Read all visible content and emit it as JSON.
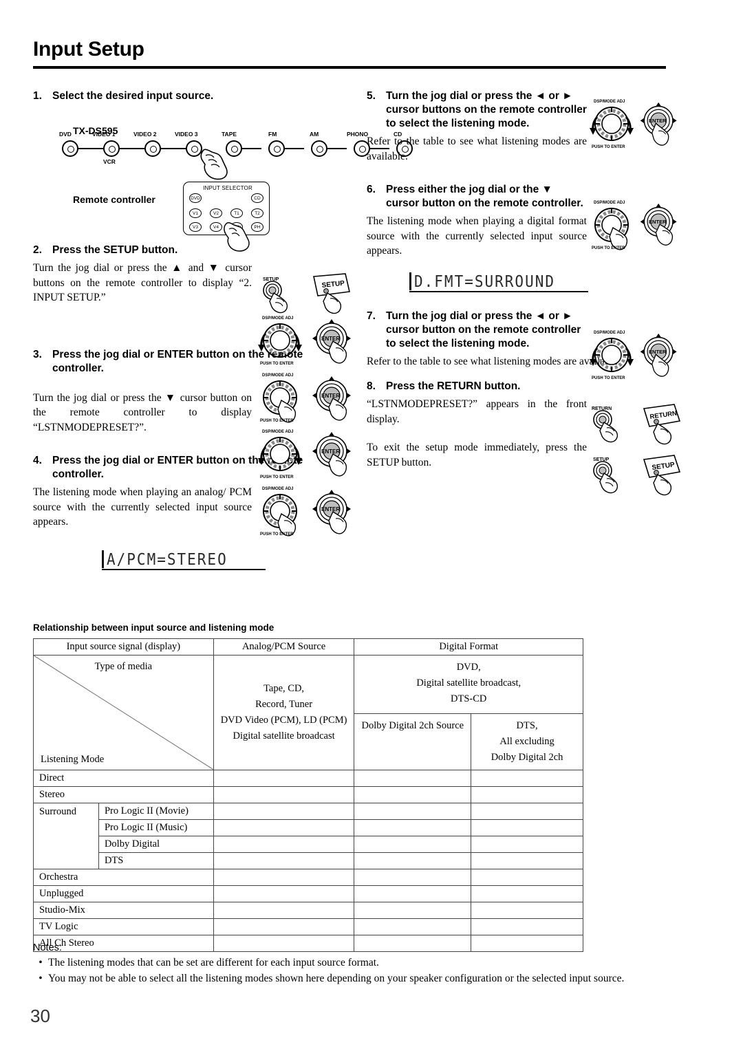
{
  "page": {
    "title": "Input Setup",
    "number": "30"
  },
  "device": {
    "model": "TX-DS595",
    "front_panel_selectors_left": [
      "DVD",
      "VIDEO 1",
      "VIDEO 2",
      "VIDEO 3"
    ],
    "front_panel_sublabel": "VCR",
    "front_panel_selectors_right": [
      "TAPE",
      "FM",
      "AM",
      "PHONO",
      "CD"
    ]
  },
  "remote": {
    "label": "Remote controller",
    "section_label": "INPUT SELECTOR",
    "buttons": [
      "DVD",
      "CD",
      "V1",
      "V2",
      "T1",
      "T2",
      "V3",
      "V4",
      "TUN",
      "PH"
    ]
  },
  "controls": {
    "jog_top_label": "DSP/MODE ADJ",
    "jog_bottom_label": "PUSH TO ENTER",
    "enter_label": "ENTER",
    "setup_label": "SETUP",
    "return_label": "RETURN"
  },
  "steps": [
    {
      "num": "1.",
      "title": "Select the desired input source.",
      "body": ""
    },
    {
      "num": "2.",
      "title": "Press the SETUP button.",
      "body": "Turn the jog dial or press the ▲ and ▼ cursor buttons on the remote controller to display “2. INPUT SETUP.”"
    },
    {
      "num": "3.",
      "title": "Press the jog dial or ENTER button on the remote controller.",
      "body": "Turn the jog dial or press the ▼ cursor button on the remote controller to display “LSTNMODEPRESET?”."
    },
    {
      "num": "4.",
      "title": "Press the jog dial or ENTER button on the remote controller.",
      "body": "The listening mode when playing an analog/ PCM source with the currently selected input source appears."
    },
    {
      "num": "5.",
      "title": "Turn the jog dial or press the ◄ or ► cursor buttons on the remote controller to select the listening mode.",
      "body": "Refer to the table to see what listening modes are available."
    },
    {
      "num": "6.",
      "title": "Press either the jog dial or the ▼ cursor button on the remote controller.",
      "body": "The listening mode when playing a digital format source with the currently selected input source appears."
    },
    {
      "num": "7.",
      "title": "Turn the jog dial or press the ◄ or ► cursor button on the remote controller to select the listening mode.",
      "body": "Refer to the table to see what listening modes are available."
    },
    {
      "num": "8.",
      "title": "Press the RETURN button.",
      "body": "“LSTNMODEPRESET?” appears in the front display.",
      "body2": "To exit the setup mode immediately, press the SETUP button."
    }
  ],
  "displays": {
    "analog_pcm": "A/PCM=STEREO",
    "digital_format": "D.FMT=SURROUND"
  },
  "table": {
    "caption": "Relationship between input source and listening mode",
    "header": {
      "col1": "Input source signal (display)",
      "col2": "Analog/PCM Source",
      "col3": "Digital Format"
    },
    "corner": {
      "top": "Type of media",
      "bottom": "Listening Mode"
    },
    "media": {
      "analog_pcm": [
        "Tape, CD,",
        "Record, Tuner",
        "DVD Video (PCM), LD (PCM)",
        "Digital satellite broadcast"
      ],
      "digital_top": [
        "DVD,",
        "Digital satellite broadcast,",
        "DTS-CD"
      ],
      "digital_sub_left": [
        "Dolby Digital 2ch Source"
      ],
      "digital_sub_right": [
        "DTS,",
        "All excluding",
        "Dolby Digital 2ch"
      ]
    },
    "rows": [
      {
        "group": "",
        "label": "Direct",
        "span": true
      },
      {
        "group": "",
        "label": "Stereo",
        "span": true
      },
      {
        "group": "Surround",
        "label": "Pro Logic II (Movie)",
        "span": false
      },
      {
        "group": "",
        "label": "Pro Logic II (Music)",
        "span": false
      },
      {
        "group": "",
        "label": "Dolby Digital",
        "span": false
      },
      {
        "group": "",
        "label": "DTS",
        "span": false
      },
      {
        "group": "",
        "label": "Orchestra",
        "span": true
      },
      {
        "group": "",
        "label": "Unplugged",
        "span": true
      },
      {
        "group": "",
        "label": "Studio-Mix",
        "span": true
      },
      {
        "group": "",
        "label": "TV Logic",
        "span": true
      },
      {
        "group": "",
        "label": "All Ch Stereo",
        "span": true
      }
    ]
  },
  "notes": {
    "heading": "Notes:",
    "bullet": "•",
    "items": [
      "The listening modes that can be set are different for each input source format.",
      "You may not be able to select all the listening modes shown here depending on your speaker configuration or the selected input source."
    ]
  }
}
